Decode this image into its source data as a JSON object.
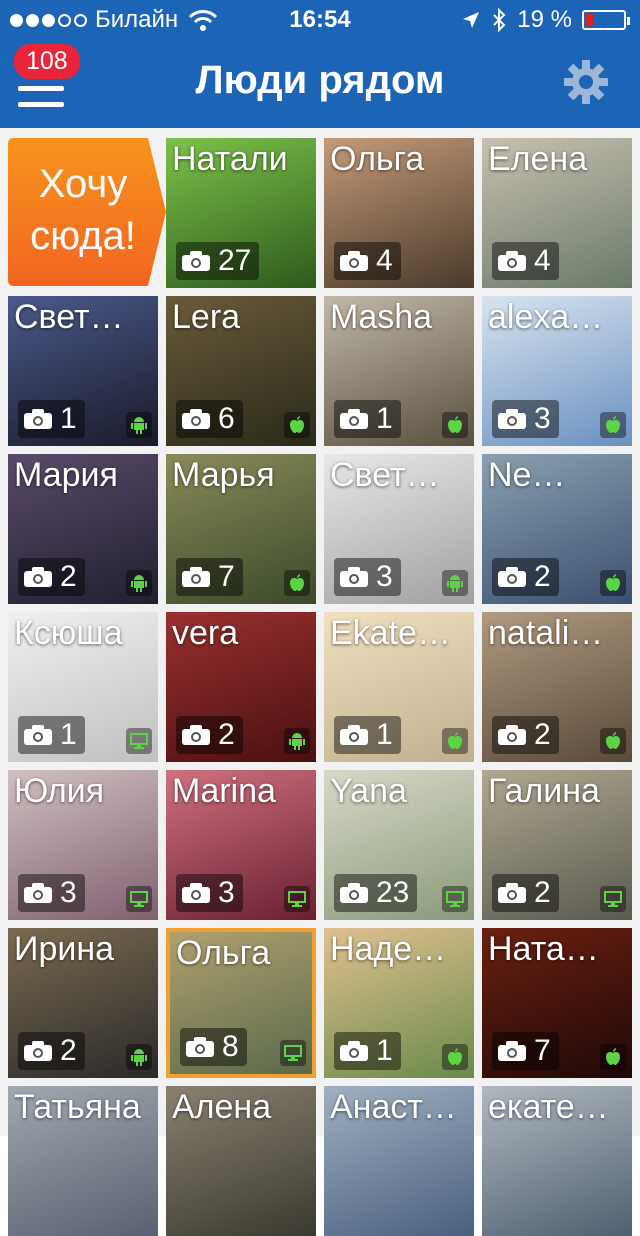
{
  "status_bar": {
    "carrier": "Билайн",
    "time": "16:54",
    "battery": "19 %",
    "battery_level": 0.19
  },
  "header": {
    "title": "Люди рядом",
    "badge_count": "108"
  },
  "want_here": {
    "label_line1": "Хочу",
    "label_line2": "сюда!"
  },
  "colors": {
    "nav": "#1c64b6",
    "want_orange": "#f26522",
    "platform_green": "#5bd544"
  },
  "people": [
    {
      "name": "Натали",
      "photos": "27",
      "platform": "none"
    },
    {
      "name": "Ольга",
      "photos": "4",
      "platform": "none"
    },
    {
      "name": "Елена",
      "photos": "4",
      "platform": "none"
    },
    {
      "name": "Свет…",
      "photos": "1",
      "platform": "android"
    },
    {
      "name": "Lera",
      "photos": "6",
      "platform": "apple"
    },
    {
      "name": "Masha",
      "photos": "1",
      "platform": "apple"
    },
    {
      "name": "alexa…",
      "photos": "3",
      "platform": "apple"
    },
    {
      "name": "Мария",
      "photos": "2",
      "platform": "android"
    },
    {
      "name": "Марья",
      "photos": "7",
      "platform": "apple"
    },
    {
      "name": "Свет…",
      "photos": "3",
      "platform": "android"
    },
    {
      "name": "Ne…",
      "photos": "2",
      "platform": "apple"
    },
    {
      "name": "Ксюша",
      "photos": "1",
      "platform": "desktop"
    },
    {
      "name": "vera",
      "photos": "2",
      "platform": "android"
    },
    {
      "name": "Ekate…",
      "photos": "1",
      "platform": "apple"
    },
    {
      "name": "natali…",
      "photos": "2",
      "platform": "apple"
    },
    {
      "name": "Юлия",
      "photos": "3",
      "platform": "desktop"
    },
    {
      "name": "Marina",
      "photos": "3",
      "platform": "desktop"
    },
    {
      "name": "Yana",
      "photos": "23",
      "platform": "desktop"
    },
    {
      "name": "Галина",
      "photos": "2",
      "platform": "desktop"
    },
    {
      "name": "Ирина",
      "photos": "2",
      "platform": "android"
    },
    {
      "name": "Ольга",
      "photos": "8",
      "platform": "desktop"
    },
    {
      "name": "Наде…",
      "photos": "1",
      "platform": "apple"
    },
    {
      "name": "Ната…",
      "photos": "7",
      "platform": "apple"
    },
    {
      "name": "Татьяна",
      "photos": "",
      "platform": "none"
    },
    {
      "name": "Алена",
      "photos": "",
      "platform": "none"
    },
    {
      "name": "Анаст…",
      "photos": "",
      "platform": "none"
    },
    {
      "name": "екате…",
      "photos": "",
      "platform": "none"
    }
  ]
}
